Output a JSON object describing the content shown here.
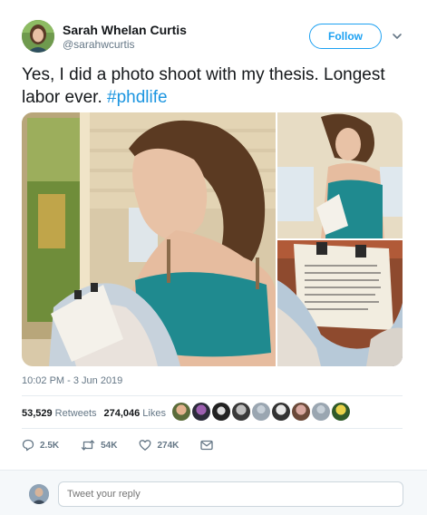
{
  "author": {
    "name": "Sarah Whelan Curtis",
    "handle": "@sarahwcurtis",
    "follow_label": "Follow"
  },
  "tweet": {
    "text": "Yes, I did a photo shoot with my thesis. Longest labor ever.",
    "hashtag": "#phdlife",
    "timestamp": "10:02 PM - 3 Jun 2019"
  },
  "stats": {
    "retweets_count": "53,529",
    "retweets_label": "Retweets",
    "likes_count": "274,046",
    "likes_label": "Likes"
  },
  "actions": {
    "reply_count": "2.5K",
    "retweet_count": "54K",
    "like_count": "274K"
  },
  "reply": {
    "placeholder": "Tweet your reply"
  },
  "colors": {
    "accent": "#1da1f2",
    "hashtag": "#1b95e0",
    "secondary_text": "#657786"
  }
}
